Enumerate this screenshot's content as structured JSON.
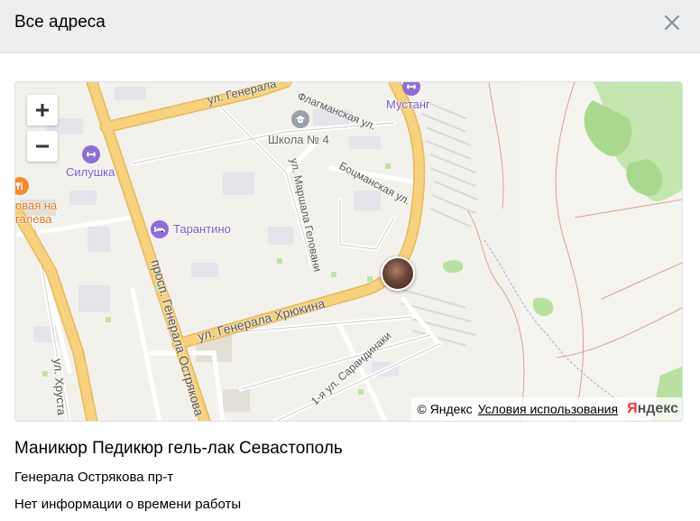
{
  "dialog": {
    "title": "Все адреса"
  },
  "map": {
    "zoom_in_label": "+",
    "zoom_out_label": "−",
    "pois": [
      {
        "name": "Мустанг",
        "icon": "fitness-icon",
        "color": "#8f6dd6"
      },
      {
        "name": "Школа № 4",
        "icon": "school-icon",
        "color": "#9aa0a8"
      },
      {
        "name": "Силушка",
        "icon": "fitness-icon",
        "color": "#8f6dd6"
      },
      {
        "name": "Тарантино",
        "icon": "bed-icon",
        "color": "#8f6dd6"
      },
      {
        "name": "овая на",
        "icon": "food-icon",
        "color": "#f08c32"
      },
      {
        "name": "галева",
        "icon": "",
        "color": "#e8793a"
      }
    ],
    "streets": [
      "ул. Генерала",
      "Флагманская ул.",
      "Боцманская ул.",
      "ул. Маршала Геловани",
      "ул. Генерала Хрюкина",
      "просп. Генерала Острякова",
      "1-я ул. Сарандинаки",
      "ул. Хруста"
    ],
    "attribution": {
      "copyright": "© Яндекс",
      "terms_link": "Условия использования",
      "logo_red": "Я",
      "logo_rest": "ндекс"
    },
    "colors": {
      "main_road": "#f6d17e",
      "park": "#b8e0a0",
      "background": "#f3f1ec"
    }
  },
  "organization": {
    "name": "Маникюр Педикюр гель-лак Севастополь",
    "address": "Генерала Острякова пр-т",
    "hours": "Нет информации о времени работы"
  }
}
